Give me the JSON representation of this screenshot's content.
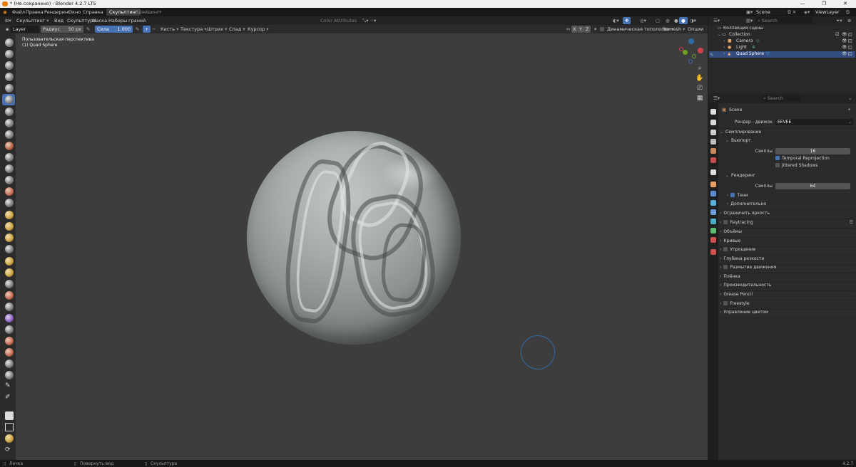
{
  "window": {
    "title": "* (Не сохранено) - Blender 4.2.7 LTS",
    "controls": [
      "—",
      "❐",
      "✕"
    ]
  },
  "menubar": {
    "items": [
      "Файл",
      "Правка",
      "Рендеринг",
      "Окно",
      "Справка"
    ],
    "workspace_tabs": [
      {
        "label": "Скульптинг",
        "active": true
      },
      {
        "label": "Шейдинг",
        "active": false
      }
    ],
    "add_tab": "+",
    "scene": {
      "label": "Scene"
    },
    "view_layer": {
      "label": "ViewLayer"
    }
  },
  "viewport_header": {
    "mode": "Скульптинг",
    "menus": [
      "Вид",
      "Скульптура",
      "Маска",
      "Наборы граней"
    ],
    "color_attributes": "Color Attributes"
  },
  "tool_header": {
    "brush_name": "Layer",
    "radius_label": "Радиус",
    "radius_value": "50 px",
    "strength_label": "Сила",
    "strength_value": "1.000",
    "menus": [
      "Кисть",
      "Текстура",
      "Штрих",
      "Спад",
      "Курсор"
    ],
    "axes": [
      "X",
      "Y",
      "Z"
    ],
    "dyntopo": "Динамическая топология",
    "remesh": "Remesh",
    "options": "Опции"
  },
  "viewport": {
    "perspective": "Пользовательская перспектива",
    "object": "(1) Quad Sphere"
  },
  "outliner": {
    "search_placeholder": "Search",
    "rows": [
      {
        "label": "Коллекция сцены",
        "selected": false
      },
      {
        "label": "Collection",
        "selected": false
      },
      {
        "label": "Camera",
        "selected": false
      },
      {
        "label": "Light",
        "selected": false
      },
      {
        "label": "Quad Sphere",
        "selected": true
      }
    ]
  },
  "properties": {
    "search_placeholder": "Search",
    "context": "Scene",
    "render_engine_label": "Рендер - движок",
    "render_engine_value": "EEVEE",
    "sampling_header": "Семплирование",
    "viewport_header": "Вьюпорт",
    "samples_label": "Сэмплы",
    "viewport_samples": "16",
    "temporal_reprojection": "Temporal Reprojection",
    "jittered_shadows": "Jittered Shadows",
    "render_header": "Рендеринг",
    "render_samples": "64",
    "shadows": "Тени",
    "advanced": "Дополнительно",
    "panels": [
      {
        "label": "Ограничить яркость",
        "checkbox": false
      },
      {
        "label": "Raytracing",
        "checkbox": true
      },
      {
        "label": "Объёмы",
        "checkbox": false
      },
      {
        "label": "Кривые",
        "checkbox": false
      },
      {
        "label": "Упрощение",
        "checkbox": true
      },
      {
        "label": "Глубина резкости",
        "checkbox": false
      },
      {
        "label": "Размытие движения",
        "checkbox": true
      },
      {
        "label": "Плёнка",
        "checkbox": false
      },
      {
        "label": "Производительность",
        "checkbox": false
      },
      {
        "label": "Grease Pencil",
        "checkbox": false
      },
      {
        "label": "Freestyle",
        "checkbox": true
      },
      {
        "label": "Управление цветом",
        "checkbox": false
      }
    ]
  },
  "statusbar": {
    "select": "Лечка",
    "rotate": "Повернуть вид",
    "sculpt": "Скульптура",
    "version": "4.2.7"
  },
  "colors": {
    "accent": "#4772b3",
    "viewport_bg": "#3d3d3d",
    "selected_row": "#334d80",
    "brush_circle": "#2f6aa8"
  }
}
